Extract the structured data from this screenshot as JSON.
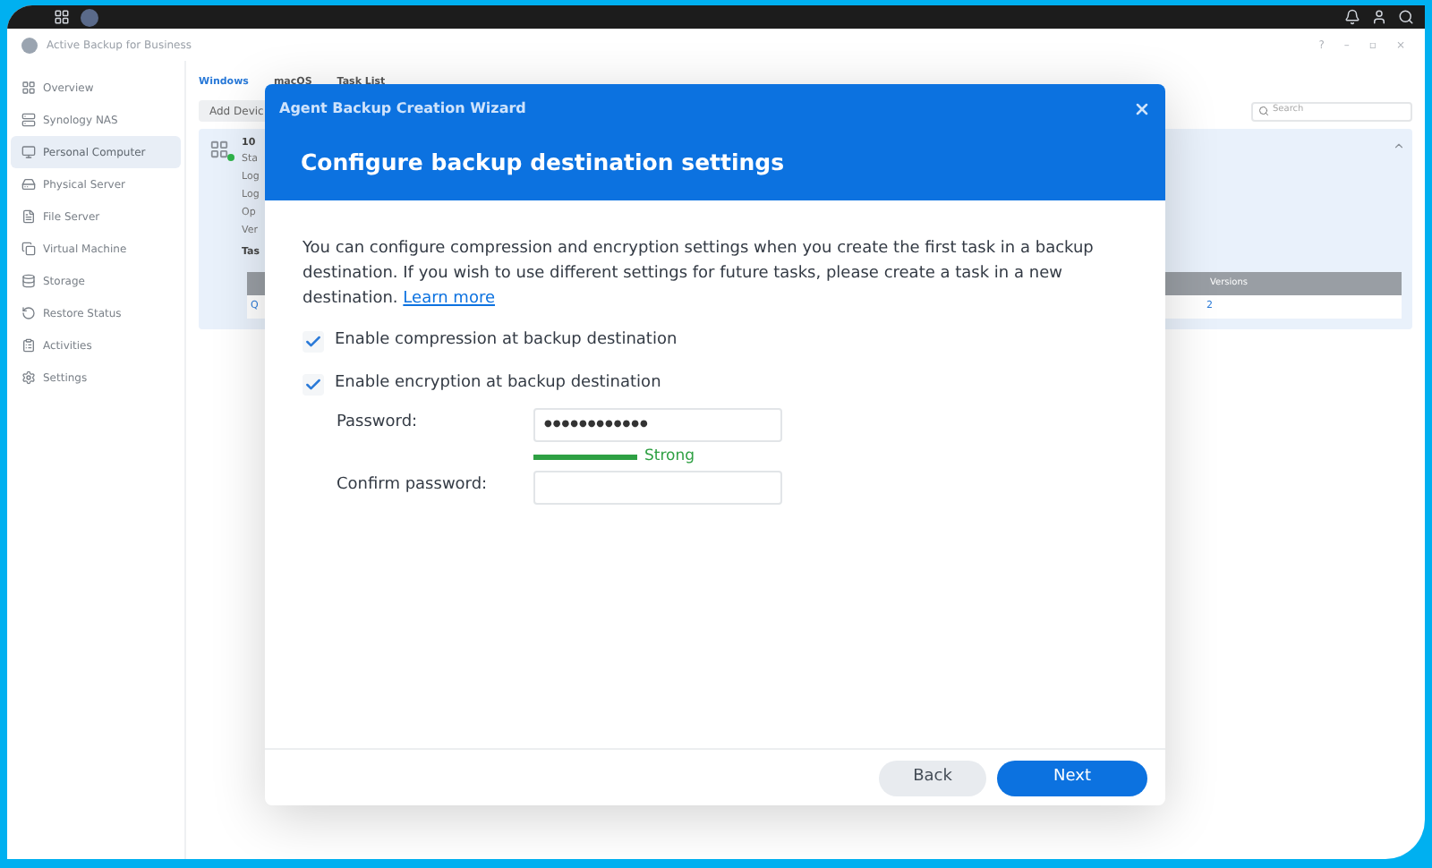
{
  "app": {
    "title": "Active Backup for Business",
    "window_controls": [
      "?",
      "–",
      "▫",
      "×"
    ]
  },
  "sidebar": {
    "items": [
      {
        "label": "Overview",
        "selected": false
      },
      {
        "label": "Synology NAS",
        "selected": false
      },
      {
        "label": "Personal Computer",
        "selected": true
      },
      {
        "label": "Physical Server",
        "selected": false
      },
      {
        "label": "File Server",
        "selected": false
      },
      {
        "label": "Virtual Machine",
        "selected": false
      },
      {
        "label": "Storage",
        "selected": false
      },
      {
        "label": "Restore Status",
        "selected": false
      },
      {
        "label": "Activities",
        "selected": false
      },
      {
        "label": "Settings",
        "selected": false
      }
    ]
  },
  "tabs": [
    {
      "label": "Windows",
      "selected": true
    },
    {
      "label": "macOS",
      "selected": false
    },
    {
      "label": "Task List",
      "selected": false
    }
  ],
  "toolbar": {
    "add_button": "Add Devic",
    "search": {
      "placeholder": "Search"
    }
  },
  "device": {
    "name": "10",
    "details": [
      "Sta",
      "Log",
      "Log",
      "Op",
      "Ver"
    ],
    "tasks_heading": "Tas",
    "online": true,
    "table": {
      "column_header": "Versions",
      "first_cell": "Q",
      "versions": "2"
    }
  },
  "dialog": {
    "title": "Agent Backup Creation Wizard",
    "heading": "Configure backup destination settings",
    "description": "You can configure compression and encryption settings when you create the first task in a backup destination. If you wish to use different settings for future tasks, please create a task in a new destination.",
    "link": "Learn more",
    "options": [
      {
        "label": "Enable compression at backup destination",
        "checked": true
      },
      {
        "label": "Enable encryption at backup destination",
        "checked": true
      }
    ],
    "password": {
      "label": "Password:",
      "value": "●●●●●●●●●●●●",
      "strength": "Strong",
      "level": 1
    },
    "confirm": {
      "label": "Confirm password:"
    },
    "buttons": [
      {
        "label": "Back",
        "kind": "secondary"
      },
      {
        "label": "Next",
        "kind": "primary"
      }
    ]
  }
}
